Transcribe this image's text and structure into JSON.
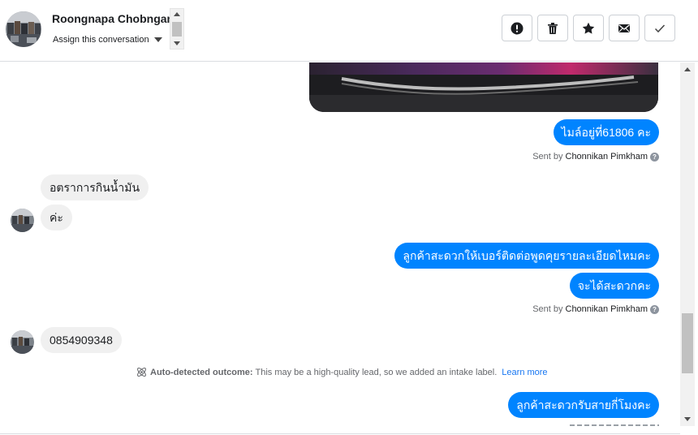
{
  "header": {
    "contact_name": "Roongnapa Chobngam",
    "assign_label": "Assign this conversation"
  },
  "actions": [
    {
      "name": "mark-spam-button",
      "icon": "exclamation-circle-icon"
    },
    {
      "name": "delete-button",
      "icon": "trash-icon"
    },
    {
      "name": "star-button",
      "icon": "star-icon"
    },
    {
      "name": "mark-unread-button",
      "icon": "envelope-icon"
    },
    {
      "name": "mark-done-button",
      "icon": "checkmark-icon"
    }
  ],
  "messages": {
    "out_1": "ไมล์อยู่ที่61806 คะ",
    "sent_prefix_1": "Sent by",
    "sent_agent_1": "Chonnikan Pimkham",
    "in_1": "อตราการกินน้ำมัน",
    "in_2": "ค่ะ",
    "out_2": "ลูกค้าสะดวกให้เบอร์ติดต่อพูดคุยรายละเอียดไหมคะ",
    "out_3": "จะได้สะดวกคะ",
    "sent_prefix_2": "Sent by",
    "sent_agent_2": "Chonnikan Pimkham",
    "in_3": "0854909348",
    "out_4": "ลูกค้าสะดวกรับสายกี่โมงคะ"
  },
  "outcome": {
    "title": "Auto-detected outcome:",
    "text": "This may be a high-quality lead, so we added an intake label.",
    "link": "Learn more"
  },
  "colors": {
    "outgoing_bubble": "#0084ff",
    "incoming_bubble": "#f0f0f0",
    "link": "#1877f2"
  }
}
